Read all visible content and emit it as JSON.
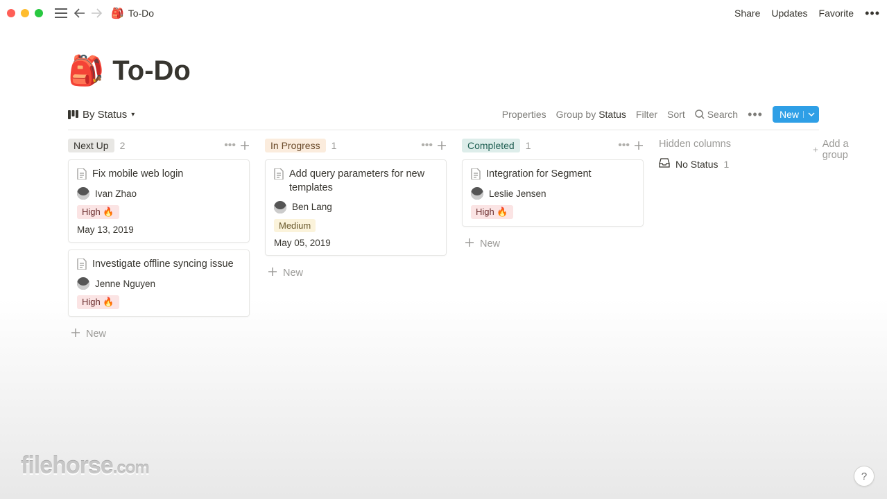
{
  "topbar": {
    "breadcrumb_icon": "🎒",
    "breadcrumb_title": "To-Do",
    "share": "Share",
    "updates": "Updates",
    "favorite": "Favorite"
  },
  "page": {
    "emoji": "🎒",
    "title": "To-Do"
  },
  "toolbar": {
    "view_label": "By Status",
    "properties": "Properties",
    "group_by_prefix": "Group by ",
    "group_by_value": "Status",
    "filter": "Filter",
    "sort": "Sort",
    "search": "Search",
    "new": "New"
  },
  "columns": [
    {
      "name": "Next Up",
      "tag_class": "tag-nextup",
      "count": "2",
      "cards": [
        {
          "title": "Fix mobile web login",
          "assignee": "Ivan Zhao",
          "priority": "High 🔥",
          "priority_class": "tag-high",
          "due": "May 13, 2019"
        },
        {
          "title": "Investigate offline syncing issue",
          "assignee": "Jenne Nguyen",
          "priority": "High 🔥",
          "priority_class": "tag-high",
          "due": ""
        }
      ],
      "add_label": "New"
    },
    {
      "name": "In Progress",
      "tag_class": "tag-inprogress",
      "count": "1",
      "cards": [
        {
          "title": "Add query parameters for new templates",
          "assignee": "Ben Lang",
          "priority": "Medium",
          "priority_class": "tag-medium",
          "due": "May 05, 2019"
        }
      ],
      "add_label": "New"
    },
    {
      "name": "Completed",
      "tag_class": "tag-completed",
      "count": "1",
      "cards": [
        {
          "title": "Integration for Segment",
          "assignee": "Leslie Jensen",
          "priority": "High 🔥",
          "priority_class": "tag-high",
          "due": ""
        }
      ],
      "add_label": "New"
    }
  ],
  "hidden": {
    "label": "Hidden columns",
    "no_status": "No Status",
    "no_status_count": "1"
  },
  "add_group": "Add a group",
  "watermark": "filehorse",
  "watermark_suffix": ".com",
  "help": "?"
}
